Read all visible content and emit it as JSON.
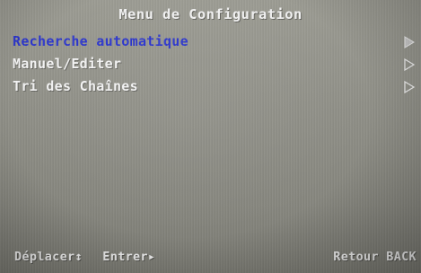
{
  "menu": {
    "title": "Menu de Configuration",
    "items": [
      {
        "label": "Recherche automatique",
        "selected": true,
        "icon": "chevron-right-icon"
      },
      {
        "label": "Manuel/Editer",
        "selected": false,
        "icon": "chevron-right-icon"
      },
      {
        "label": "Tri des Chaînes",
        "selected": false,
        "icon": "chevron-right-icon"
      }
    ]
  },
  "footer": {
    "move": "Déplacer↕",
    "enter": "Entrer▸",
    "back": "Retour BACK"
  },
  "colors": {
    "selected_text": "#2a34cc",
    "text": "#f4f4f4",
    "background": "#8e8e86"
  }
}
